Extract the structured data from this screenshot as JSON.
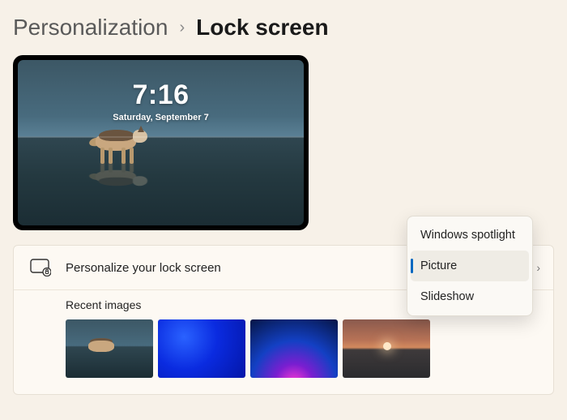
{
  "breadcrumb": {
    "parent": "Personalization",
    "current": "Lock screen"
  },
  "preview": {
    "time": "7:16",
    "date": "Saturday, September 7"
  },
  "section": {
    "personalize_label": "Personalize your lock screen",
    "recent_label": "Recent images"
  },
  "dropdown": {
    "options": [
      "Windows spotlight",
      "Picture",
      "Slideshow"
    ],
    "selected_index": 1
  }
}
